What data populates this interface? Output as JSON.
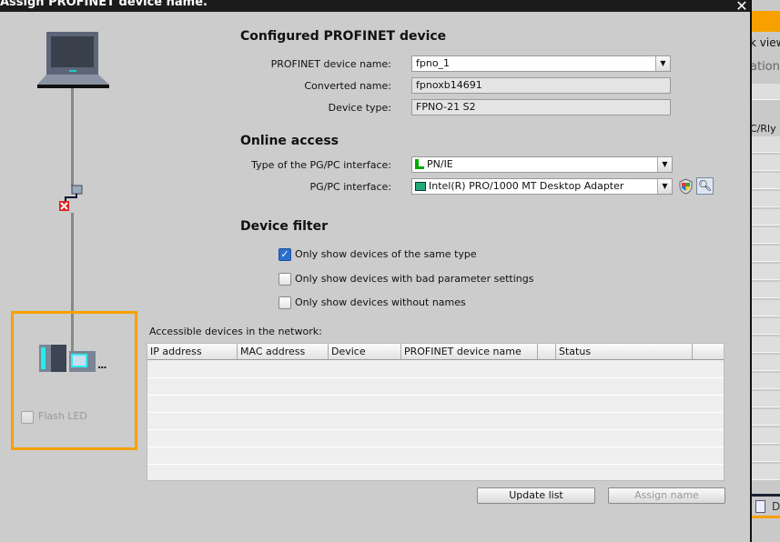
{
  "dialog": {
    "title": "Assign PROFINET device name.",
    "close": "✕"
  },
  "configured": {
    "heading": "Configured PROFINET device",
    "device_name_label": "PROFINET device name:",
    "device_name_value": "fpno_1",
    "converted_label": "Converted name:",
    "converted_value": "fpnoxb14691",
    "type_label": "Device type:",
    "type_value": "FPNO-21 S2"
  },
  "online": {
    "heading": "Online access",
    "if_type_label": "Type of the PG/PC interface:",
    "if_type_value": "PN/IE",
    "if_label": "PG/PC interface:",
    "if_value": "Intel(R) PRO/1000 MT Desktop Adapter"
  },
  "filter": {
    "heading": "Device filter",
    "options": [
      {
        "label": "Only show devices of the same type",
        "checked": true
      },
      {
        "label": "Only show devices with bad parameter settings",
        "checked": false
      },
      {
        "label": "Only show devices without names",
        "checked": false
      }
    ]
  },
  "network": {
    "caption": "Accessible devices in the network:",
    "columns": [
      "IP address",
      "MAC address",
      "Device",
      "PROFINET device name",
      "",
      "Status",
      ""
    ]
  },
  "left": {
    "flash_led": "Flash LED",
    "more": "..."
  },
  "buttons": {
    "update": "Update list",
    "assign": "Assign name"
  },
  "background": {
    "t1": "k view",
    "t2": "ations",
    "t3": "C/Rly",
    "t4": "D"
  },
  "colors": {
    "accent": "#f7a000"
  }
}
